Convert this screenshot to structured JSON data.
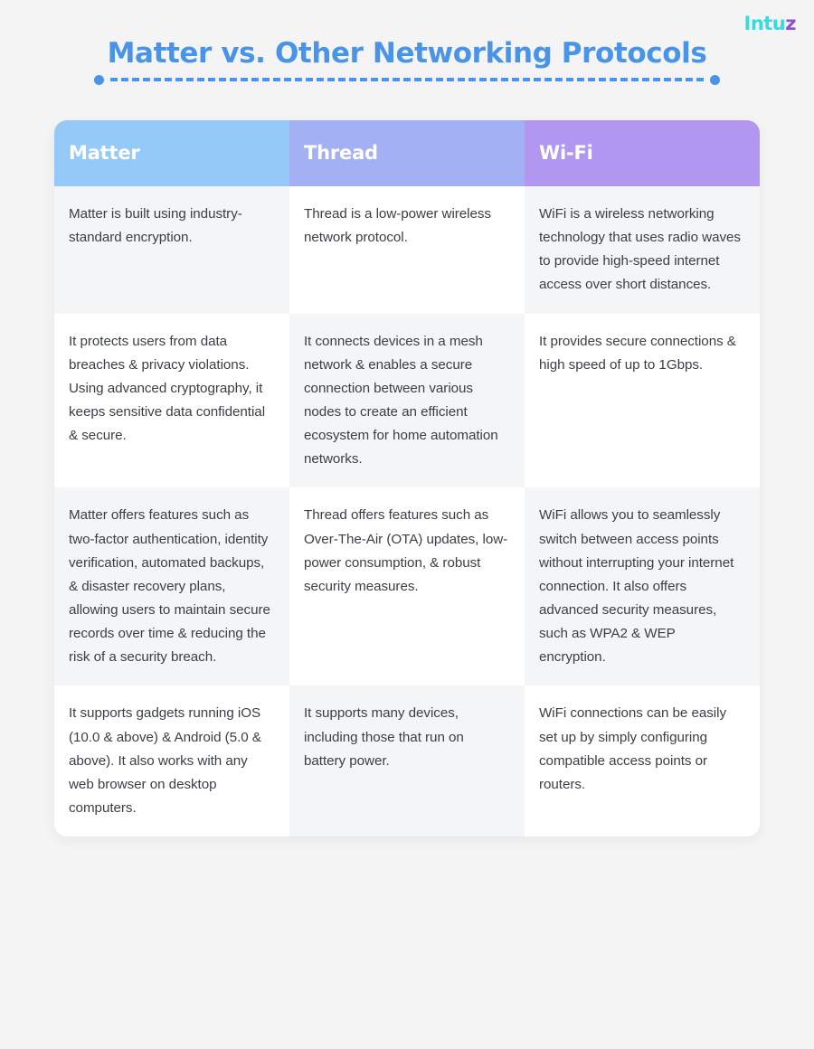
{
  "logo": {
    "main": "Intu",
    "accent": "z",
    "color_main": "#36dbe0",
    "color_accent": "#8c4fd6"
  },
  "header": {
    "title": "Matter vs. Other Networking Protocols",
    "title_color": "#4a94e8",
    "divider_color": "#4a94e8"
  },
  "table": {
    "columns": [
      {
        "label": "Matter",
        "color": "#95c9f7"
      },
      {
        "label": "Thread",
        "color": "#a3b0f4"
      },
      {
        "label": "Wi-Fi",
        "color": "#b197f0"
      }
    ],
    "rows": [
      {
        "matter": "Matter is built using industry- standard encryption.",
        "thread": "Thread is a low-power wireless network protocol.",
        "wifi": "WiFi is a wireless networking technology that uses radio waves to provide high-speed internet access over short distances."
      },
      {
        "matter": "It protects users from data breaches & privacy violations. Using advanced cryptography, it keeps sensitive data confidential & secure.",
        "thread": "It connects devices in a mesh network & enables a secure connection between various nodes to create an efficient ecosystem for home automation networks.",
        "wifi": "It provides secure connections & high speed of up to 1Gbps."
      },
      {
        "matter": "Matter offers features such as two-factor authentication, identity verification, automated backups, & disaster recovery plans, allowing users to maintain secure records over time & reducing the risk of a security breach.",
        "thread": "Thread offers features such as Over-The-Air (OTA) updates, low-power consumption, & robust security measures.",
        "wifi": "WiFi allows you to seamlessly switch between access points without interrupting your internet connection. It also offers advanced security measures, such as WPA2 & WEP encryption."
      },
      {
        "matter": "It supports gadgets running iOS (10.0 & above) & Android (5.0 & above). It also works with any web browser on desktop computers.",
        "thread": "It supports many devices, including those that run on battery power.",
        "wifi": "WiFi connections can be easily set up by simply configuring compatible access points or routers."
      }
    ]
  }
}
